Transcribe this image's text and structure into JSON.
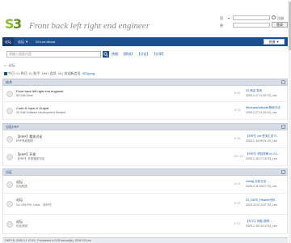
{
  "header": {
    "site_title": "Front back left right end engineer",
    "login_user_label": "用",
    "login_pass_label": "密",
    "login_button": "登录",
    "register_link": "注册"
  },
  "nav": {
    "items": [
      "论坛",
      "论坛 ▼",
      "S3 Lee About"
    ],
    "right_button": "快捷 ▼"
  },
  "search": {
    "placeholder": "请输入搜索内容",
    "hotwords_label": "热搜:",
    "hotwords": [
      "【原创】",
      "【讨论】",
      "【分享】"
    ]
  },
  "breadcrumb": {
    "home": "⌂",
    "forum": "论坛"
  },
  "stats": {
    "text": "今日: 0 | 昨日: 0 | 帖子: 194 | 会员: 15 | 欢迎新会员:",
    "newest_member": "322yong"
  },
  "categories": [
    {
      "title": "技术",
      "rows": [
        {
          "name": "Front back left right end engineer",
          "desc": "S3 Soft Store",
          "count": "5 / 5",
          "last": "S3 商店 发布",
          "date": "2025-1-17 11:52 S3_Lee"
        },
        {
          "name": "Code & Input & Output",
          "desc": "S3 Soft Software Development Related",
          "count": "3 / 3",
          "last": "WindowsDefender禁用方法",
          "date": "2025-2-27 11:53 S3_Lee"
        }
      ]
    },
    {
      "title": "分区ERP",
      "rows": [
        {
          "name": "【ERP】相关讨论",
          "desc": "ERP系统相关",
          "count": "6 / 6",
          "last": "【ERP】xxx 任务汇总 R...",
          "date": "2025-1-14 09:21 S3_Lee"
        },
        {
          "name": "【ERP】开发",
          "desc": "【ERP】开发相关讨论",
          "count": "12 / 12",
          "last": "【ERP】项目说明 v1.0.0...",
          "date": "2025-1-15 17:15 S3_Lee"
        }
      ]
    },
    {
      "title": "分区",
      "rows": [
        {
          "name": "论坛",
          "desc": "论坛相关",
          "count": "4 / 4",
          "last": "ch4dig 分析方法 ...",
          "date": "2025-2-11 09:47 S3_Lee"
        },
        {
          "name": "论坛",
          "desc": "C#, DELPHI, Linux, 【ERP】",
          "count": "9 / 9",
          "last": "S3_DATE_Rewrite分析...",
          "date": "2024-12-9 13:07 S3_Lee"
        },
        {
          "name": "论坛",
          "desc": "论坛测试",
          "count": "2 / 2",
          "last": "【ATC】功能 说明 ...",
          "date": "2025-1-15 15:12 S3_Lee"
        }
      ]
    }
  ],
  "footer": {
    "text": "GMT+8, 2025-3-1 10:19 , Processed in 0.05 second(s), 2024 S3 Lee"
  },
  "colors": {
    "nav": "#1f4e8c",
    "category_header": "#d7dde6",
    "link": "#1a5ba6",
    "logo_green": "#8cb83a"
  }
}
